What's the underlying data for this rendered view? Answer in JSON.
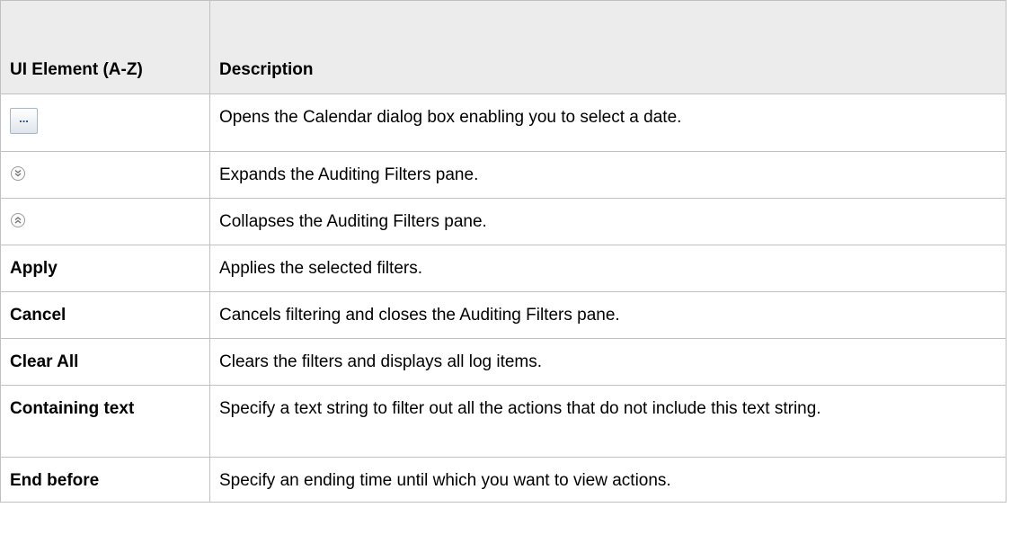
{
  "header": {
    "ui_element": "UI Element (A-Z)",
    "description": "Description"
  },
  "rows": [
    {
      "ui_element": "...",
      "icon": "ellipsis-button-icon",
      "description": "Opens the Calendar dialog box enabling you to select a date."
    },
    {
      "ui_element": "",
      "icon": "expand-double-chevron-down-icon",
      "description": "Expands the Auditing Filters pane."
    },
    {
      "ui_element": "",
      "icon": "collapse-double-chevron-up-icon",
      "description": "Collapses the Auditing Filters pane."
    },
    {
      "ui_element": "Apply",
      "description": "Applies the selected filters."
    },
    {
      "ui_element": "Cancel",
      "description": "Cancels filtering and closes the Auditing Filters pane."
    },
    {
      "ui_element": "Clear All",
      "description": "Clears the filters and displays all log items."
    },
    {
      "ui_element": "Containing text",
      "description": "Specify a text string to filter out all the actions that do not include this text string."
    },
    {
      "ui_element": "End before",
      "description": "Specify an ending time until which you want to view actions."
    }
  ],
  "colors": {
    "header_bg": "#ececec",
    "border": "#c0c0c0",
    "icon_blue": "#1c4f8f"
  }
}
